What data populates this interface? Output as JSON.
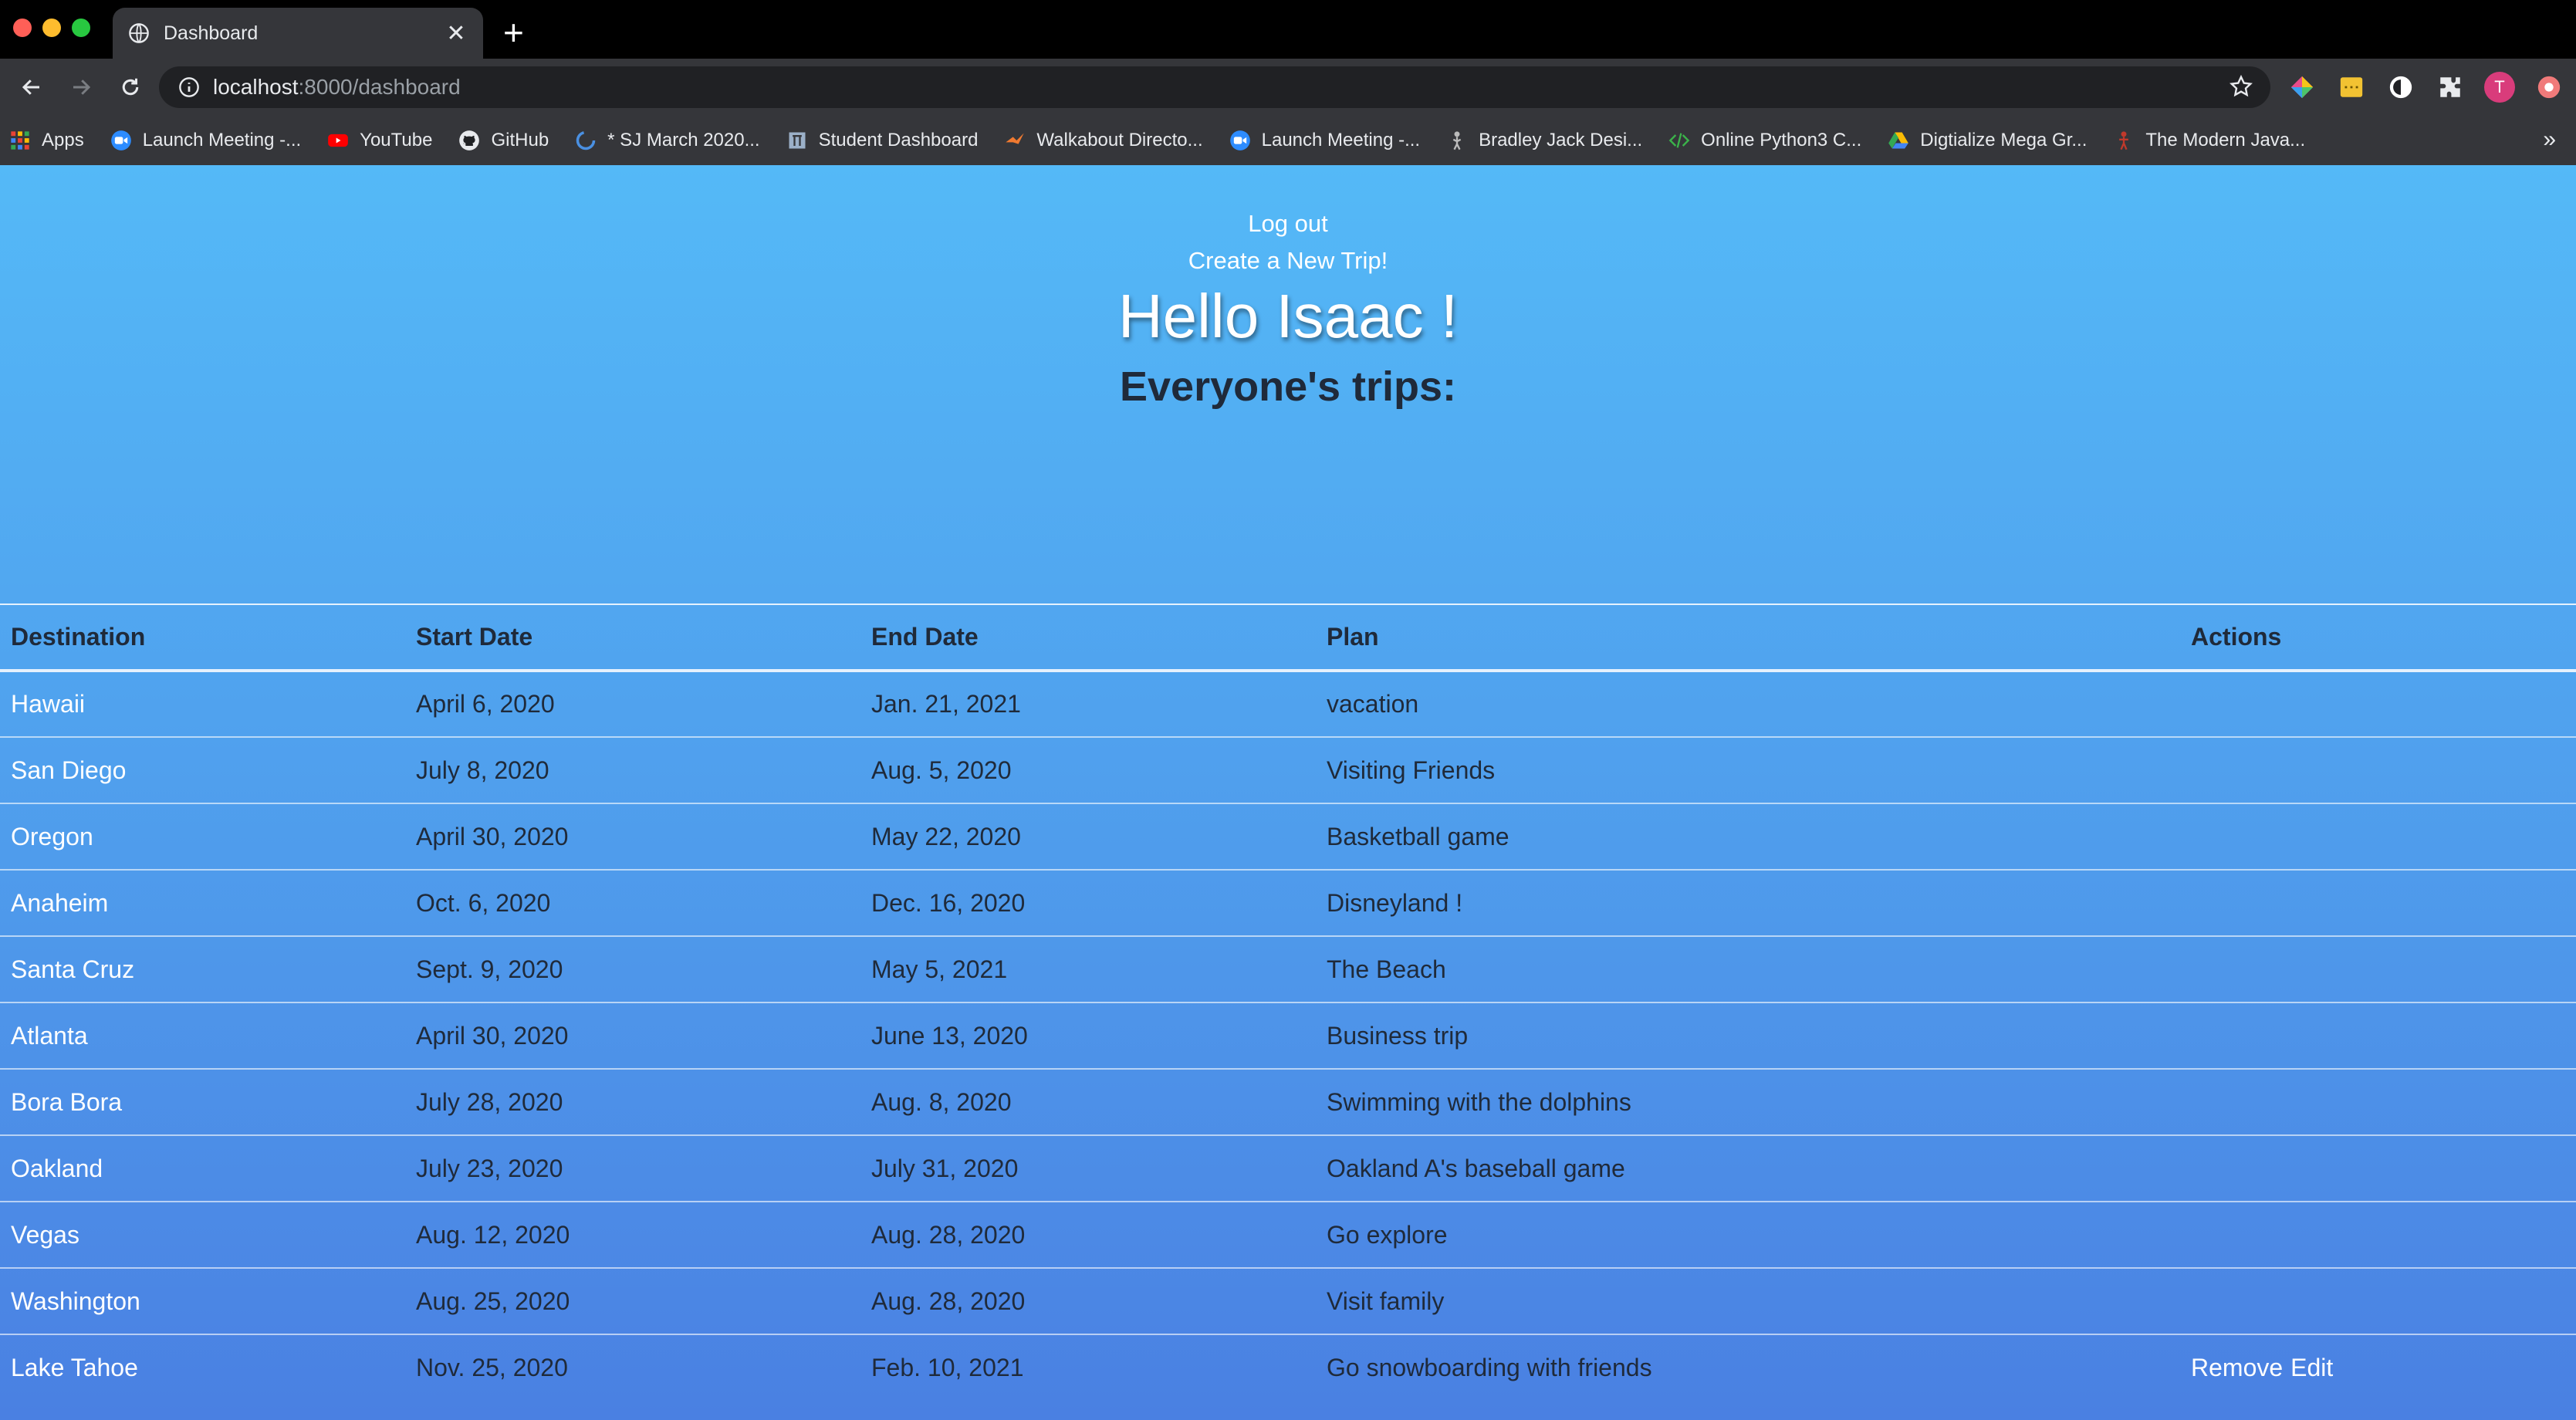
{
  "browser": {
    "tab_title": "Dashboard",
    "url_host": "localhost",
    "url_path": ":8000/dashboard",
    "avatar_letter": "T",
    "bookmarks": [
      {
        "label": "Apps",
        "icon": "apps-grid-icon"
      },
      {
        "label": "Launch Meeting -...",
        "icon": "zoom-icon"
      },
      {
        "label": "YouTube",
        "icon": "youtube-icon"
      },
      {
        "label": "GitHub",
        "icon": "github-icon"
      },
      {
        "label": "* SJ March 2020...",
        "icon": "spinner-icon"
      },
      {
        "label": "Student Dashboard",
        "icon": "gate-icon"
      },
      {
        "label": "Walkabout Directo...",
        "icon": "bird-icon"
      },
      {
        "label": "Launch Meeting -...",
        "icon": "zoom-icon"
      },
      {
        "label": "Bradley Jack Desi...",
        "icon": "figure-icon"
      },
      {
        "label": "Online Python3 C...",
        "icon": "code-icon"
      },
      {
        "label": "Digtialize Mega Gr...",
        "icon": "drive-icon"
      },
      {
        "label": "The Modern Java...",
        "icon": "person-icon"
      }
    ],
    "more_label": "»"
  },
  "page": {
    "logout_label": "Log out",
    "create_label": "Create a New Trip!",
    "greeting": "Hello Isaac !",
    "subheading": "Everyone's trips:"
  },
  "table": {
    "headers": [
      "Destination",
      "Start Date",
      "End Date",
      "Plan",
      "Actions"
    ],
    "rows": [
      {
        "destination": "Hawaii",
        "start": "April 6, 2020",
        "end": "Jan. 21, 2021",
        "plan": "vacation",
        "actions": []
      },
      {
        "destination": "San Diego",
        "start": "July 8, 2020",
        "end": "Aug. 5, 2020",
        "plan": "Visiting Friends",
        "actions": []
      },
      {
        "destination": "Oregon",
        "start": "April 30, 2020",
        "end": "May 22, 2020",
        "plan": "Basketball game",
        "actions": []
      },
      {
        "destination": "Anaheim",
        "start": "Oct. 6, 2020",
        "end": "Dec. 16, 2020",
        "plan": "Disneyland !",
        "actions": []
      },
      {
        "destination": "Santa Cruz",
        "start": "Sept. 9, 2020",
        "end": "May 5, 2021",
        "plan": "The Beach",
        "actions": []
      },
      {
        "destination": "Atlanta",
        "start": "April 30, 2020",
        "end": "June 13, 2020",
        "plan": "Business trip",
        "actions": []
      },
      {
        "destination": "Bora Bora",
        "start": "July 28, 2020",
        "end": "Aug. 8, 2020",
        "plan": "Swimming with the dolphins",
        "actions": []
      },
      {
        "destination": "Oakland",
        "start": "July 23, 2020",
        "end": "July 31, 2020",
        "plan": "Oakland A's baseball game",
        "actions": []
      },
      {
        "destination": "Vegas",
        "start": "Aug. 12, 2020",
        "end": "Aug. 28, 2020",
        "plan": "Go explore",
        "actions": []
      },
      {
        "destination": "Washington",
        "start": "Aug. 25, 2020",
        "end": "Aug. 28, 2020",
        "plan": "Visit family",
        "actions": []
      },
      {
        "destination": "Lake Tahoe",
        "start": "Nov. 25, 2020",
        "end": "Feb. 10, 2021",
        "plan": "Go snowboarding with friends",
        "actions": [
          "Remove",
          "Edit"
        ]
      }
    ]
  },
  "colors": {
    "gradient_top": "#54b9f7",
    "gradient_bottom": "#4a80e2",
    "dark_text": "#1f2a3a",
    "chrome_bg": "#35363a"
  }
}
